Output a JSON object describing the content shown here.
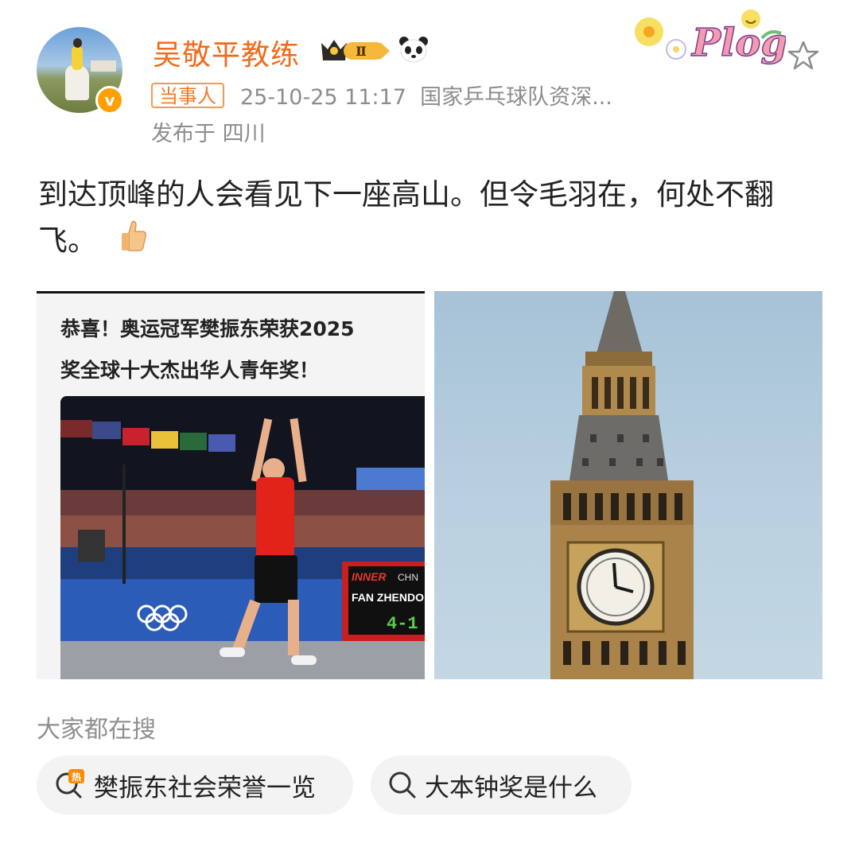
{
  "post": {
    "author": "吴敬平教练",
    "vip_level": "Ⅱ",
    "role_tag": "当事人",
    "timestamp": "25-10-25 11:17",
    "author_title": "国家乒乓球队资深...",
    "location": "发布于 四川",
    "sticker_text": "Plog",
    "verified_badge": "v",
    "content": "到达顶峰的人会看见下一座高山。但令毛羽在，何处不翻飞。"
  },
  "images": [
    {
      "headline_line1": "恭喜！奥运冠军樊振东荣获2025",
      "headline_line2": "奖全球十大杰出华人青年奖！",
      "scoreboard_winner": "INNER",
      "scoreboard_country": "CHN",
      "scoreboard_name": "FAN ZHENDO",
      "scoreboard_score": "4-1"
    },
    {
      "description": "clock-tower"
    }
  ],
  "search": {
    "label": "大家都在搜",
    "chips": [
      {
        "text": "樊振东社会荣誉一览",
        "icon": "hot-search-icon",
        "icon_text": "热"
      },
      {
        "text": "大本钟奖是什么",
        "icon": "search-icon"
      }
    ]
  },
  "colors": {
    "username": "#f26a1b",
    "tag_border": "#f39a4c",
    "meta": "#8c8c8c",
    "chip_bg": "#f3f3f3"
  }
}
